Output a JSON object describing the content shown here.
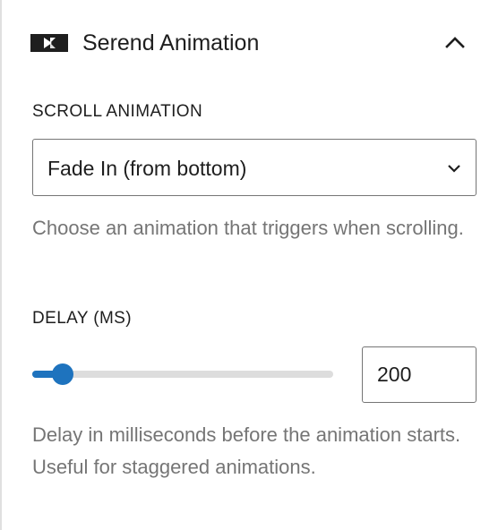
{
  "panel": {
    "title": "Serend Animation",
    "logo_icon": "serend-logo-icon",
    "toggle_icon": "chevron-up-icon",
    "expanded": true
  },
  "scroll_animation": {
    "label": "SCROLL ANIMATION",
    "selected_value": "Fade In (from bottom)",
    "dropdown_icon": "chevron-down-icon",
    "help_text": "Choose an animation that triggers when scrolling."
  },
  "delay": {
    "label": "DELAY (MS)",
    "value": "200",
    "slider_fraction": 0.1,
    "help_text": "Delay in milliseconds before the animation starts. Useful for staggered animations."
  },
  "colors": {
    "accent": "#1e73be",
    "text": "#1e1e1e",
    "help_text": "#757575",
    "border": "#757575",
    "track": "#dddddd"
  }
}
